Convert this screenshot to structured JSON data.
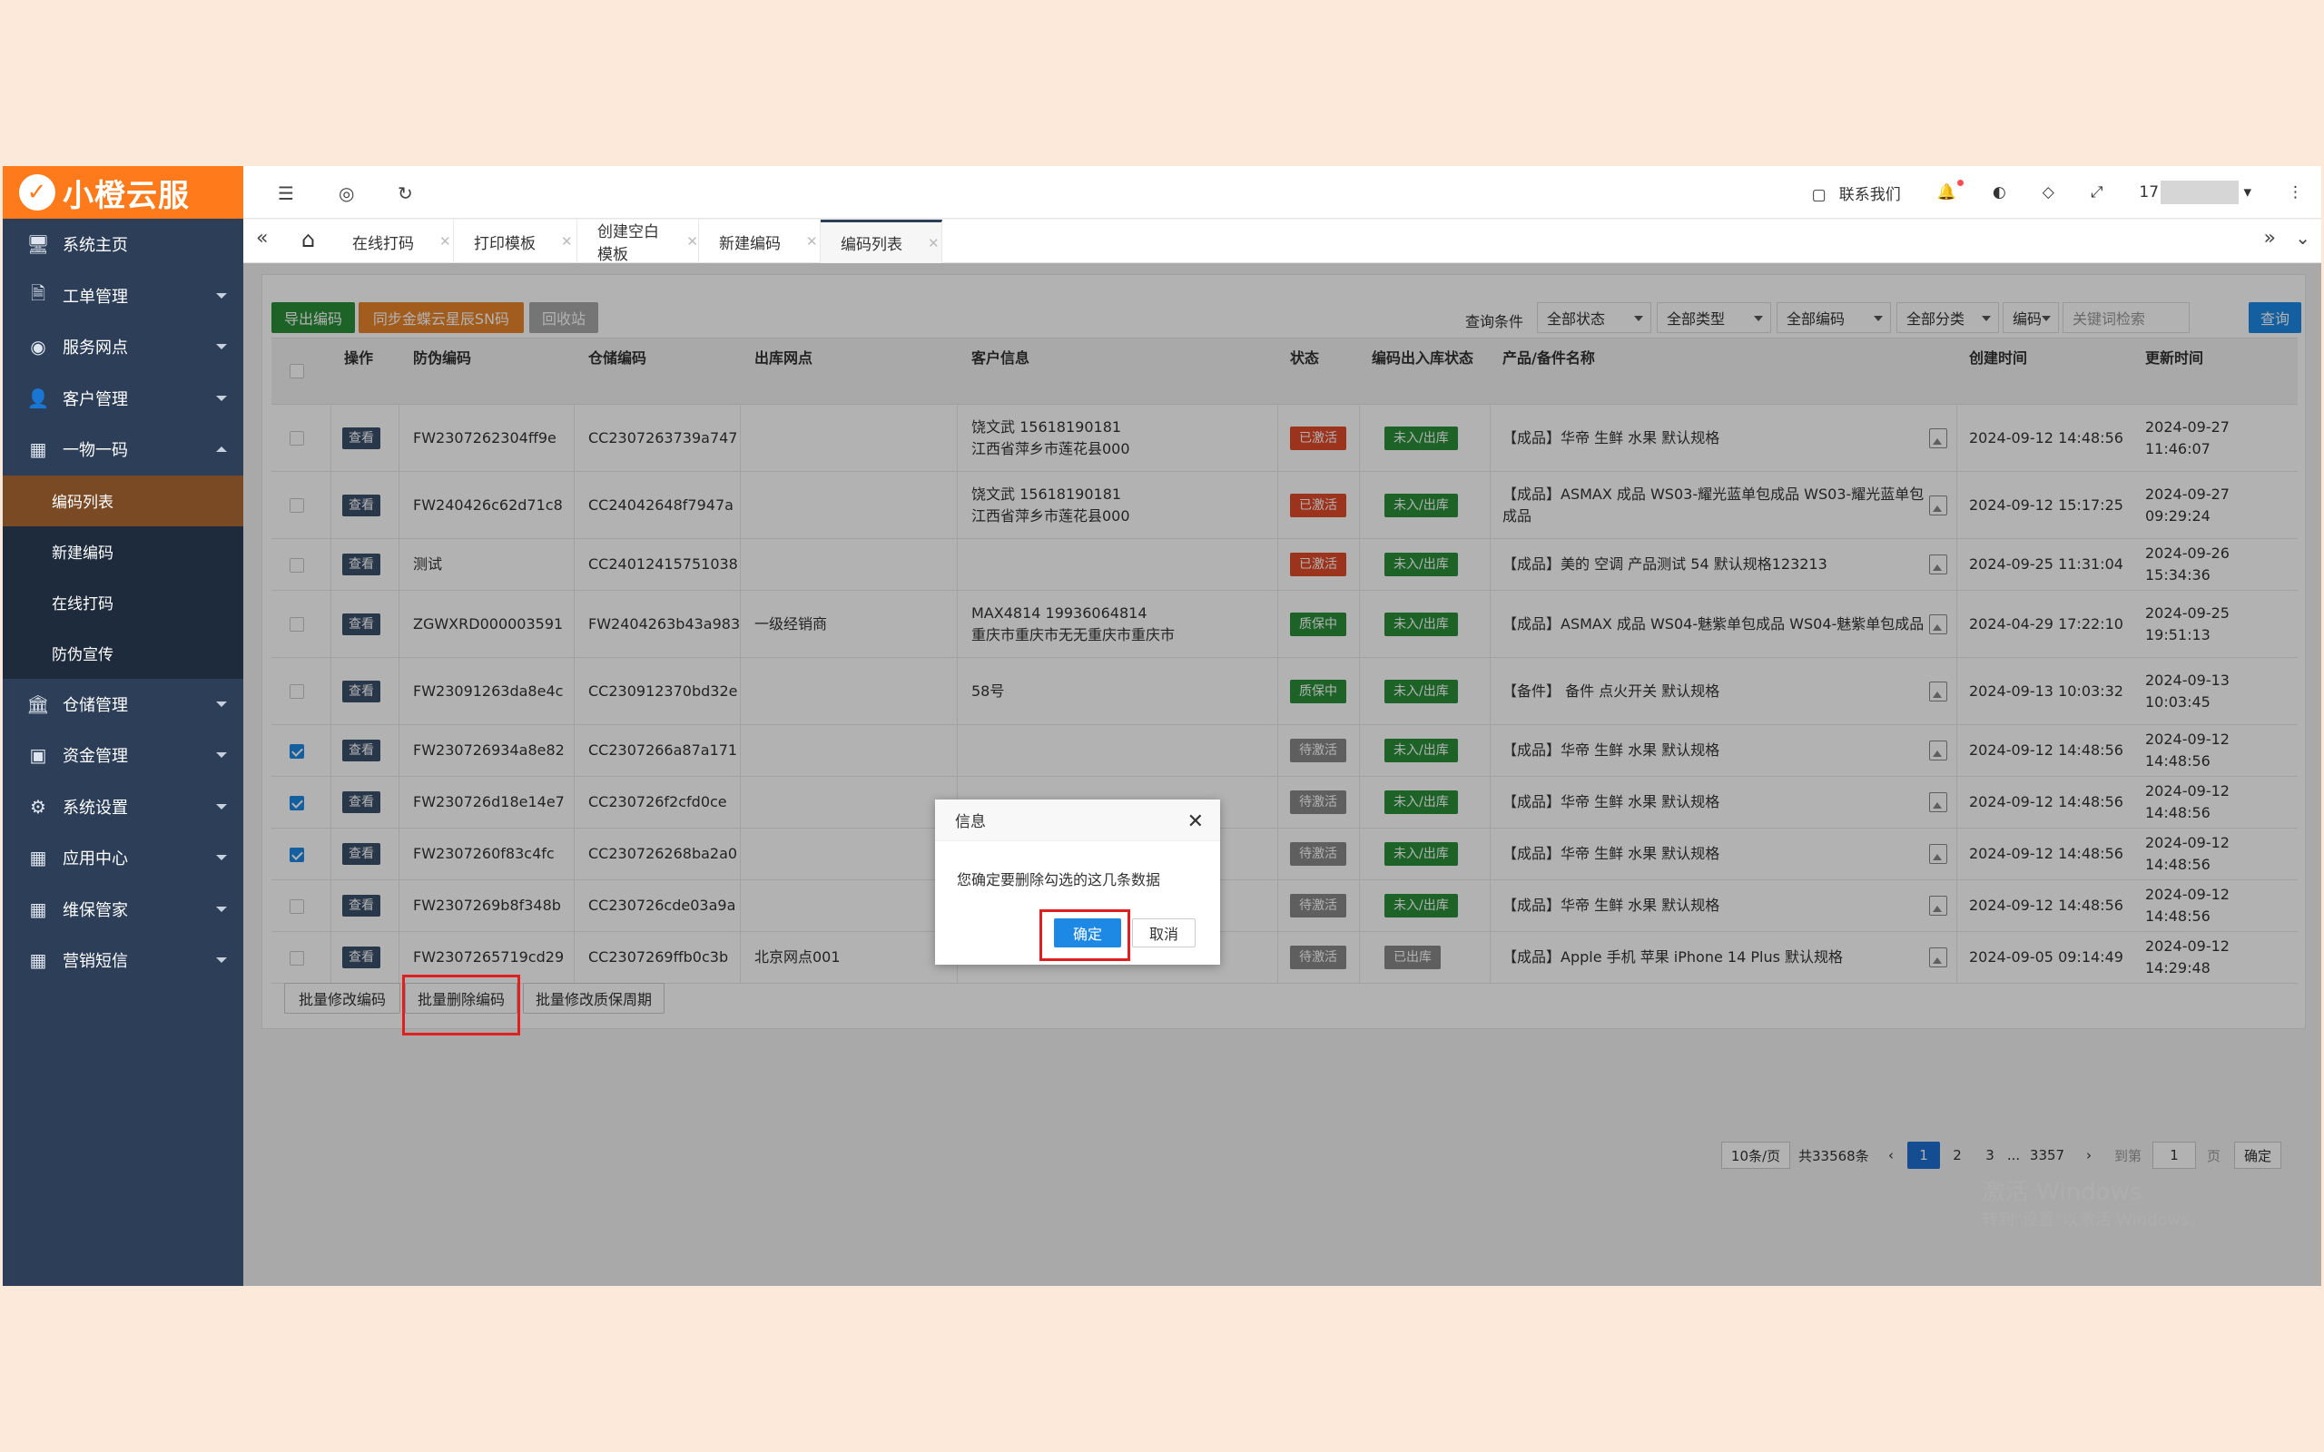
{
  "app": {
    "logo_text": "小橙云服"
  },
  "sidebar": {
    "items": [
      {
        "label": "系统主页",
        "icon": "monitor-icon",
        "glyph": "🖥"
      },
      {
        "label": "工单管理",
        "icon": "document-icon",
        "glyph": "🗎"
      },
      {
        "label": "服务网点",
        "icon": "globe-icon",
        "glyph": "◉"
      },
      {
        "label": "客户管理",
        "icon": "user-icon",
        "glyph": "👤"
      },
      {
        "label": "一物一码",
        "icon": "grid-icon",
        "glyph": "▦"
      }
    ],
    "sub_items": [
      {
        "label": "编码列表",
        "active": true
      },
      {
        "label": "新建编码"
      },
      {
        "label": "在线打码"
      },
      {
        "label": "防伪宣传"
      }
    ],
    "items_after": [
      {
        "label": "仓储管理",
        "icon": "bank-icon",
        "glyph": "🏛"
      },
      {
        "label": "资金管理",
        "icon": "money-icon",
        "glyph": "▣"
      },
      {
        "label": "系统设置",
        "icon": "gear-icon",
        "glyph": "⚙"
      },
      {
        "label": "应用中心",
        "icon": "grid-icon",
        "glyph": "▦"
      },
      {
        "label": "维保管家",
        "icon": "grid-icon",
        "glyph": "▦"
      },
      {
        "label": "营销短信",
        "icon": "grid-icon",
        "glyph": "▦"
      }
    ]
  },
  "header": {
    "contact": "联系我们",
    "user": "17"
  },
  "tabs": [
    {
      "label": "在线打码"
    },
    {
      "label": "打印模板"
    },
    {
      "label": "创建空白模板"
    },
    {
      "label": "新建编码"
    },
    {
      "label": "编码列表",
      "active": true
    }
  ],
  "toolbar": {
    "export": "导出编码",
    "sync": "同步金蝶云星辰SN码",
    "recycle": "回收站",
    "query_label": "查询条件",
    "filters": [
      "全部状态",
      "全部类型",
      "全部编码",
      "全部分类",
      "编码"
    ],
    "search_placeholder": "关键词检索",
    "query_btn": "查询"
  },
  "table": {
    "headers": [
      "操作",
      "防伪编码",
      "仓储编码",
      "出库网点",
      "客户信息",
      "状态",
      "编码出入库状态",
      "产品/备件名称",
      "创建时间",
      "更新时间"
    ],
    "view_label": "查看",
    "rows": [
      {
        "checked": false,
        "code": "FW2307262304ff9e",
        "store": "CC2307263739a747",
        "outlet": "",
        "customer1": "饶文武 15618190181",
        "customer2": "江西省萍乡市莲花县000",
        "status": "已激活",
        "status_color": "#e04a2a",
        "io": "未入/出库",
        "product": "【成品】华帝 生鲜 水果 默认规格",
        "product2": "",
        "created": "2024-09-12 14:48:56",
        "updated": "2024-09-27 11:46:07"
      },
      {
        "checked": false,
        "code": "FW240426c62d71c8",
        "store": "CC24042648f7947a",
        "outlet": "",
        "customer1": "饶文武 15618190181",
        "customer2": "江西省萍乡市莲花县000",
        "status": "已激活",
        "status_color": "#e04a2a",
        "io": "未入/出库",
        "product": "【成品】ASMAX 成品 WS03-耀光蓝单包成品 WS03-耀光蓝单包",
        "product2": "成品",
        "created": "2024-09-12 15:17:25",
        "updated": "2024-09-27 09:29:24"
      },
      {
        "checked": false,
        "code": "测试",
        "store": "CC24012415751038",
        "outlet": "",
        "customer1": "",
        "customer2": "",
        "status": "已激活",
        "status_color": "#e04a2a",
        "io": "未入/出库",
        "product": "【成品】美的 空调 产品测试 54 默认规格123213",
        "product2": "",
        "created": "2024-09-25 11:31:04",
        "updated": "2024-09-26 15:34:36"
      },
      {
        "checked": false,
        "code": "ZGWXRD000003591",
        "store": "FW2404263b43a983",
        "outlet": "一级经销商",
        "customer1": "MAX4814 19936064814",
        "customer2": "重庆市重庆市无无重庆市重庆市",
        "status": "质保中",
        "status_color": "#2a8f3a",
        "io": "未入/出库",
        "product": "【成品】ASMAX 成品 WS04-魅紫单包成品 WS04-魅紫单包成品",
        "product2": "",
        "created": "2024-04-29 17:22:10",
        "updated": "2024-09-25 19:51:13"
      },
      {
        "checked": false,
        "code": "FW23091263da8e4c",
        "store": "CC230912370bd32e",
        "outlet": "",
        "customer1": "",
        "customer2": "58号",
        "status": "质保中",
        "status_color": "#2a8f3a",
        "io": "未入/出库",
        "product": "【备件】 备件 点火开关 默认规格",
        "product2": "",
        "created": "2024-09-13 10:03:32",
        "updated": "2024-09-13 10:03:45"
      },
      {
        "checked": true,
        "code": "FW230726934a8e82",
        "store": "CC2307266a87a171",
        "outlet": "",
        "customer1": "",
        "customer2": "",
        "status": "待激活",
        "status_color": "#888888",
        "io": "未入/出库",
        "product": "【成品】华帝 生鲜 水果 默认规格",
        "product2": "",
        "created": "2024-09-12 14:48:56",
        "updated": "2024-09-12 14:48:56"
      },
      {
        "checked": true,
        "code": "FW230726d18e14e7",
        "store": "CC230726f2cfd0ce",
        "outlet": "",
        "customer1": "",
        "customer2": "",
        "status": "待激活",
        "status_color": "#888888",
        "io": "未入/出库",
        "product": "【成品】华帝 生鲜 水果 默认规格",
        "product2": "",
        "created": "2024-09-12 14:48:56",
        "updated": "2024-09-12 14:48:56"
      },
      {
        "checked": true,
        "code": "FW2307260f83c4fc",
        "store": "CC230726268ba2a0",
        "outlet": "",
        "customer1": "",
        "customer2": "",
        "status": "待激活",
        "status_color": "#888888",
        "io": "未入/出库",
        "product": "【成品】华帝 生鲜 水果 默认规格",
        "product2": "",
        "created": "2024-09-12 14:48:56",
        "updated": "2024-09-12 14:48:56"
      },
      {
        "checked": false,
        "code": "FW2307269b8f348b",
        "store": "CC230726cde03a9a",
        "outlet": "",
        "customer1": "",
        "customer2": "",
        "status": "待激活",
        "status_color": "#888888",
        "io": "未入/出库",
        "product": "【成品】华帝 生鲜 水果 默认规格",
        "product2": "",
        "created": "2024-09-12 14:48:56",
        "updated": "2024-09-12 14:48:56"
      },
      {
        "checked": false,
        "code": "FW2307265719cd29",
        "store": "CC2307269ffb0c3b",
        "outlet": "北京网点001",
        "customer1": "",
        "customer2": "",
        "status": "待激活",
        "status_color": "#888888",
        "io": "已出库",
        "io_color": "#888888",
        "product": "【成品】Apple 手机 苹果 iPhone 14 Plus 默认规格",
        "product2": "",
        "created": "2024-09-05 09:14:49",
        "updated": "2024-09-12 14:29:48"
      }
    ]
  },
  "bottom": {
    "batch_edit": "批量修改编码",
    "batch_delete": "批量删除编码",
    "batch_warranty": "批量修改质保周期",
    "page_size": "10条/页",
    "total": "共33568条",
    "pages": [
      "1",
      "2",
      "3",
      "...",
      "3357"
    ],
    "goto_label": "到第",
    "goto_value": "1",
    "page_unit": "页",
    "confirm": "确定"
  },
  "dialog": {
    "title": "信息",
    "message": "您确定要删除勾选的这几条数据",
    "ok": "确定",
    "cancel": "取消"
  },
  "watermark": {
    "line1": "激活 Windows",
    "line2": "转到\"设置\"以激活 Windows。"
  }
}
